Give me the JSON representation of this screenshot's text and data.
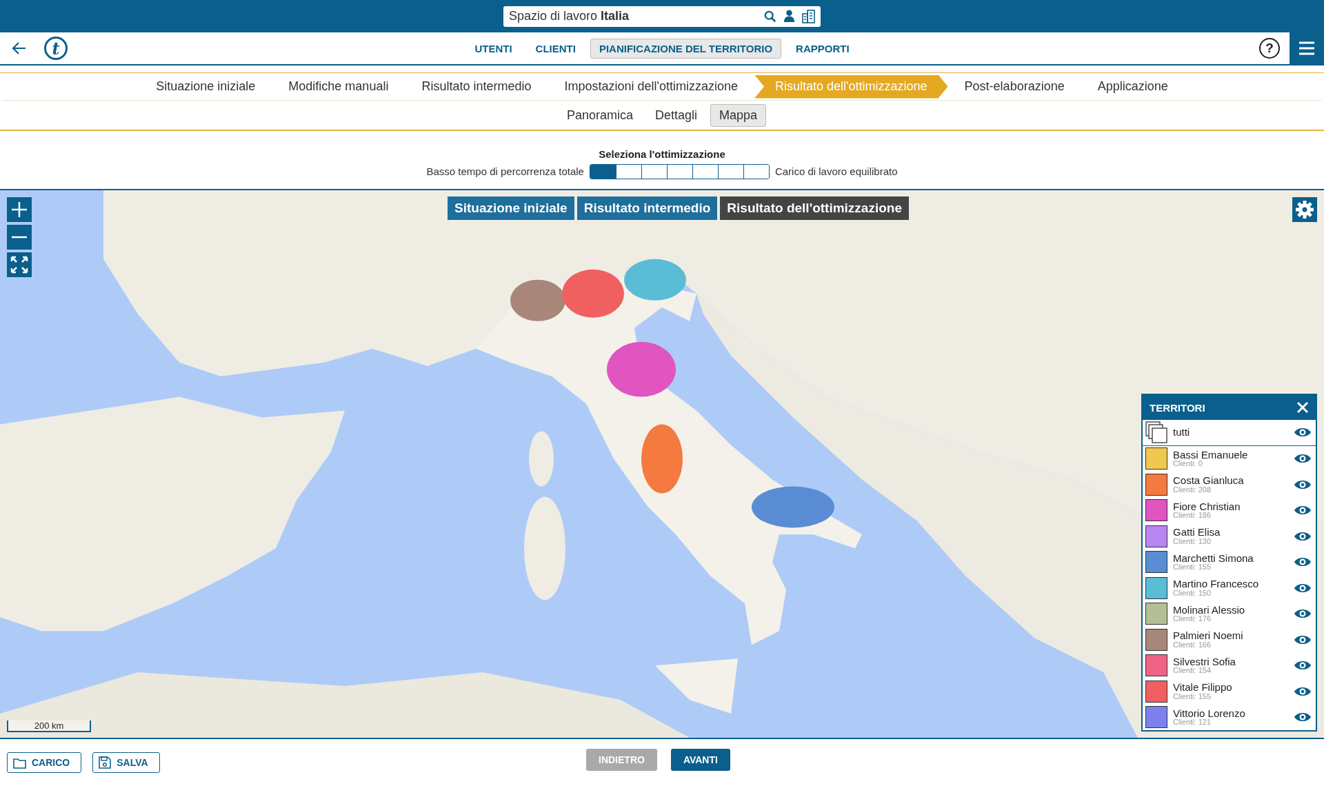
{
  "header": {
    "workspace_label": "Spazio di lavoro",
    "workspace_name": "Italia"
  },
  "logo": {
    "letter": "t"
  },
  "nav_tabs": [
    {
      "label": "UTENTI",
      "selected": false
    },
    {
      "label": "CLIENTI",
      "selected": false
    },
    {
      "label": "PIANIFICAZIONE DEL TERRITORIO",
      "selected": true
    },
    {
      "label": "RAPPORTI",
      "selected": false
    }
  ],
  "help": "?",
  "steps": [
    {
      "label": "Situazione iniziale",
      "selected": false
    },
    {
      "label": "Modifiche manuali",
      "selected": false
    },
    {
      "label": "Risultato intermedio",
      "selected": false
    },
    {
      "label": "Impostazioni dell'ottimizzazione",
      "selected": false
    },
    {
      "label": "Risultato dell'ottimizzazione",
      "selected": true
    },
    {
      "label": "Post-elaborazione",
      "selected": false
    },
    {
      "label": "Applicazione",
      "selected": false
    }
  ],
  "sub_tabs": [
    {
      "label": "Panoramica",
      "selected": false
    },
    {
      "label": "Dettagli",
      "selected": false
    },
    {
      "label": "Mappa",
      "selected": true
    }
  ],
  "optimization_selector": {
    "title": "Seleziona l'ottimizzazione",
    "left_label": "Basso tempo di percorrenza totale",
    "right_label": "Carico di lavoro equilibrato",
    "options": [
      {
        "selected": true
      },
      {
        "selected": false
      },
      {
        "selected": false
      },
      {
        "selected": false
      },
      {
        "selected": false
      },
      {
        "selected": false
      },
      {
        "selected": false
      }
    ]
  },
  "map": {
    "kind": "picture",
    "layer_buttons": [
      {
        "label": "Situazione iniziale",
        "selected": false
      },
      {
        "label": "Risultato intermedio",
        "selected": false
      },
      {
        "label": "Risultato dell'ottimizzazione",
        "selected": true
      }
    ],
    "scale": "200 km"
  },
  "territories_panel": {
    "title": "TERRITORI",
    "all_label": "tutti",
    "all_visible": true,
    "items": [
      {
        "name": "Bassi Emanuele",
        "clients": "Clienti: 0",
        "color": "#f0c850",
        "visible": true
      },
      {
        "name": "Costa Gianluca",
        "clients": "Clienti: 208",
        "color": "#f47a40",
        "visible": true
      },
      {
        "name": "Fiore Christian",
        "clients": "Clienti: 186",
        "color": "#e055c0",
        "visible": true
      },
      {
        "name": "Gatti Elisa",
        "clients": "Clienti: 130",
        "color": "#b985f0",
        "visible": true
      },
      {
        "name": "Marchetti Simona",
        "clients": "Clienti: 155",
        "color": "#5a8cd4",
        "visible": true
      },
      {
        "name": "Martino Francesco",
        "clients": "Clienti: 150",
        "color": "#5bbcd6",
        "visible": true
      },
      {
        "name": "Molinari Alessio",
        "clients": "Clienti: 176",
        "color": "#b3c095",
        "visible": true
      },
      {
        "name": "Palmieri Noemi",
        "clients": "Clienti: 166",
        "color": "#a8867a",
        "visible": true
      },
      {
        "name": "Silvestri Sofia",
        "clients": "Clienti: 154",
        "color": "#ef6485",
        "visible": true
      },
      {
        "name": "Vitale Filippo",
        "clients": "Clienti: 155",
        "color": "#f06060",
        "visible": true
      },
      {
        "name": "Vittorio Lorenzo",
        "clients": "Clienti: 121",
        "color": "#7e80f0",
        "visible": true
      }
    ]
  },
  "footer": {
    "left_buttons": [
      {
        "label": "CARICO",
        "kind": "open"
      },
      {
        "label": "SALVA",
        "kind": "save"
      }
    ],
    "back_button": {
      "label": "INDIETRO",
      "disabled": true
    },
    "next_button": {
      "label": "AVANTI",
      "disabled": false
    }
  }
}
